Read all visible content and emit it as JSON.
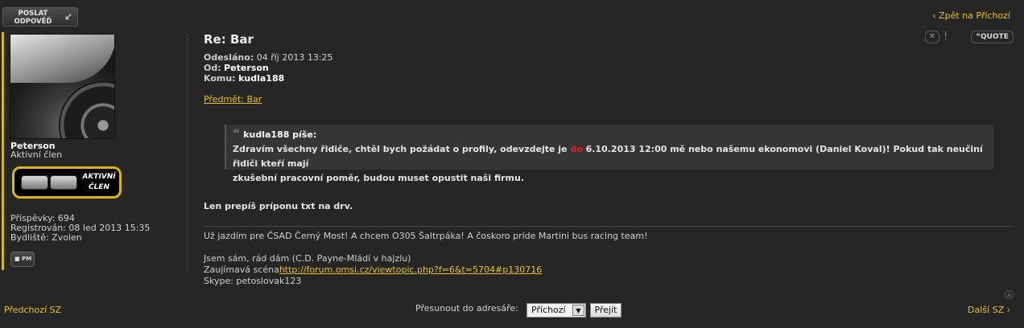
{
  "toolbar": {
    "reply_label_1": "POSLAT",
    "reply_label_2": "ODPOVĚĎ",
    "back_link": "‹ Zpět na Příchozí"
  },
  "author": {
    "name": "Peterson",
    "rank": "Aktivní člen",
    "badge_line1": "AKTIVNÍ",
    "badge_line2": "ČLEN",
    "posts": "Příspěvky: 694",
    "registered": "Registrován: 08 led 2013 15:35",
    "location": "Bydliště: Zvolen",
    "pm_label": "PM"
  },
  "message": {
    "subject": "Re: Bar",
    "sent_label": "Odesláno:",
    "sent_value": "04 říj 2013 13:25",
    "from_label": "Od:",
    "from_value": "Peterson",
    "to_label": "Komu:",
    "to_value": "kudla188",
    "topic": "Předmět: Bar",
    "quote": {
      "author": "kudla188 píše:",
      "text_1": "Zdravím všechny řidiče, chtěl bych požádat o profily, odevzdejte je ",
      "text_red": "do",
      "text_2": " 6.10.2013 12:00 mě nebo našemu ekonomovi (Daniel Koval)! Pokud tak neučiní řidiči kteří mají",
      "text_3": "zkušební pracovní poměr, budou muset opustit naši firmu."
    },
    "body": "Len prepíš príponu txt na drv.",
    "signature": {
      "line1": "Už jazdím pre ČSAD Černý Most! A chcem O305 Šaltrpáka! A čoskoro príde Martini bus racing team!",
      "line2": "Jsem sám, rád dám (C.D. Payne-Mládí v hajzlu)",
      "line3_prefix": "Zaujímavá scéna",
      "line3_link": "http://forum.omsi.cz/viewtopic.php?f=6&t=5704#p130716",
      "line4": "Skype: petoslovak123"
    },
    "actions": {
      "delete_icon": "x-icon",
      "report_icon": "warning-icon",
      "quote_label": "QUOTE"
    }
  },
  "footer": {
    "prev": "Předchozí SZ",
    "next": "Další SZ ›",
    "move_label": "Přesunout do adresáře:",
    "folder_selected": "Příchozí",
    "go_label": "Přejít"
  },
  "colors": {
    "accent": "#e8c21c",
    "background": "#262626",
    "quote_bg": "#353535",
    "highlight_red": "#e02020"
  }
}
